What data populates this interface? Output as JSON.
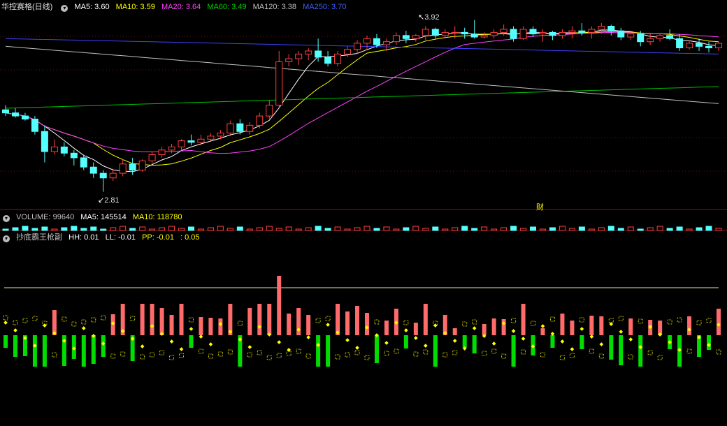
{
  "main": {
    "title": "华控赛格(日线)",
    "ma5": "MA5: 3.60",
    "ma10": "MA10: 3.59",
    "ma20": "MA20: 3.64",
    "ma60": "MA60: 3.49",
    "ma120": "MA120: 3.38",
    "ma250": "MA250: 3.70",
    "high_label": "3.92",
    "low_label": "2.81",
    "marker": "财",
    "colors": {
      "up": "#ff4040",
      "down": "#54ffff",
      "ma5": "#ffffff",
      "ma10": "#ffff00",
      "ma20": "#ff40ff",
      "ma60": "#00c000",
      "ma120": "#c0c0c0",
      "ma250": "#4040ff"
    }
  },
  "volume": {
    "label": "VOLUME: 99640",
    "ma5": "MA5: 145514",
    "ma10": "MA10: 118780"
  },
  "indicator": {
    "title": "抄底霸王枪副",
    "hh": "HH: 0.01",
    "ll": "LL: -0.01",
    "pp": "PP: -0.01",
    "extra": ": 0.05"
  },
  "chart_data": {
    "type": "candlestick",
    "price_range": [
      2.75,
      3.95
    ],
    "high": 3.92,
    "low": 2.81,
    "last_values": {
      "ma5": 3.6,
      "ma10": 3.59,
      "ma20": 3.64,
      "ma60": 3.49,
      "ma120": 3.38,
      "ma250": 3.7
    },
    "candles_ohlc": [
      [
        3.34,
        3.37,
        3.3,
        3.32
      ],
      [
        3.32,
        3.35,
        3.29,
        3.3
      ],
      [
        3.3,
        3.32,
        3.27,
        3.28
      ],
      [
        3.28,
        3.3,
        3.18,
        3.2
      ],
      [
        3.2,
        3.24,
        3.0,
        3.07
      ],
      [
        3.07,
        3.15,
        3.05,
        3.1
      ],
      [
        3.1,
        3.13,
        3.04,
        3.06
      ],
      [
        3.06,
        3.08,
        2.98,
        3.03
      ],
      [
        3.03,
        3.05,
        2.95,
        2.97
      ],
      [
        2.97,
        3.0,
        2.9,
        2.93
      ],
      [
        2.93,
        2.95,
        2.81,
        2.9
      ],
      [
        2.9,
        2.96,
        2.88,
        2.93
      ],
      [
        2.93,
        3.02,
        2.91,
        2.99
      ],
      [
        2.99,
        3.03,
        2.92,
        2.95
      ],
      [
        2.95,
        3.02,
        2.94,
        3.01
      ],
      [
        3.01,
        3.07,
        2.99,
        3.05
      ],
      [
        3.05,
        3.1,
        3.03,
        3.08
      ],
      [
        3.08,
        3.12,
        3.06,
        3.1
      ],
      [
        3.1,
        3.15,
        3.08,
        3.14
      ],
      [
        3.14,
        3.18,
        3.11,
        3.13
      ],
      [
        3.13,
        3.18,
        3.11,
        3.15
      ],
      [
        3.15,
        3.19,
        3.14,
        3.17
      ],
      [
        3.17,
        3.21,
        3.15,
        3.19
      ],
      [
        3.19,
        3.27,
        3.17,
        3.25
      ],
      [
        3.25,
        3.28,
        3.18,
        3.2
      ],
      [
        3.2,
        3.26,
        3.18,
        3.24
      ],
      [
        3.24,
        3.32,
        3.22,
        3.3
      ],
      [
        3.3,
        3.4,
        3.28,
        3.37
      ],
      [
        3.37,
        3.72,
        3.35,
        3.65
      ],
      [
        3.65,
        3.7,
        3.62,
        3.67
      ],
      [
        3.67,
        3.72,
        3.63,
        3.7
      ],
      [
        3.7,
        3.74,
        3.66,
        3.72
      ],
      [
        3.72,
        3.8,
        3.65,
        3.68
      ],
      [
        3.68,
        3.72,
        3.62,
        3.64
      ],
      [
        3.64,
        3.72,
        3.62,
        3.7
      ],
      [
        3.7,
        3.75,
        3.68,
        3.73
      ],
      [
        3.73,
        3.79,
        3.7,
        3.77
      ],
      [
        3.77,
        3.82,
        3.73,
        3.8
      ],
      [
        3.8,
        3.83,
        3.74,
        3.76
      ],
      [
        3.76,
        3.8,
        3.72,
        3.78
      ],
      [
        3.78,
        3.84,
        3.76,
        3.82
      ],
      [
        3.82,
        3.85,
        3.77,
        3.8
      ],
      [
        3.8,
        3.83,
        3.78,
        3.82
      ],
      [
        3.82,
        3.88,
        3.79,
        3.86
      ],
      [
        3.86,
        3.87,
        3.8,
        3.82
      ],
      [
        3.82,
        3.86,
        3.8,
        3.84
      ],
      [
        3.84,
        3.88,
        3.8,
        3.84
      ],
      [
        3.84,
        3.87,
        3.8,
        3.83
      ],
      [
        3.83,
        3.92,
        3.8,
        3.81
      ],
      [
        3.81,
        3.84,
        3.8,
        3.82
      ],
      [
        3.82,
        3.86,
        3.8,
        3.84
      ],
      [
        3.84,
        3.89,
        3.82,
        3.86
      ],
      [
        3.86,
        3.88,
        3.78,
        3.8
      ],
      [
        3.8,
        3.88,
        3.79,
        3.86
      ],
      [
        3.86,
        3.88,
        3.81,
        3.83
      ],
      [
        3.83,
        3.86,
        3.78,
        3.84
      ],
      [
        3.84,
        3.85,
        3.79,
        3.82
      ],
      [
        3.82,
        3.86,
        3.8,
        3.84
      ],
      [
        3.84,
        3.88,
        3.8,
        3.85
      ],
      [
        3.85,
        3.9,
        3.82,
        3.84
      ],
      [
        3.84,
        3.88,
        3.8,
        3.86
      ],
      [
        3.86,
        3.9,
        3.83,
        3.88
      ],
      [
        3.88,
        3.89,
        3.82,
        3.85
      ],
      [
        3.85,
        3.87,
        3.79,
        3.81
      ],
      [
        3.81,
        3.85,
        3.79,
        3.83
      ],
      [
        3.83,
        3.85,
        3.75,
        3.78
      ],
      [
        3.78,
        3.83,
        3.76,
        3.8
      ],
      [
        3.8,
        3.83,
        3.78,
        3.82
      ],
      [
        3.82,
        3.86,
        3.79,
        3.8
      ],
      [
        3.8,
        3.83,
        3.72,
        3.74
      ],
      [
        3.74,
        3.79,
        3.73,
        3.77
      ],
      [
        3.77,
        3.8,
        3.72,
        3.75
      ],
      [
        3.75,
        3.78,
        3.71,
        3.74
      ],
      [
        3.74,
        3.78,
        3.72,
        3.77
      ]
    ]
  }
}
